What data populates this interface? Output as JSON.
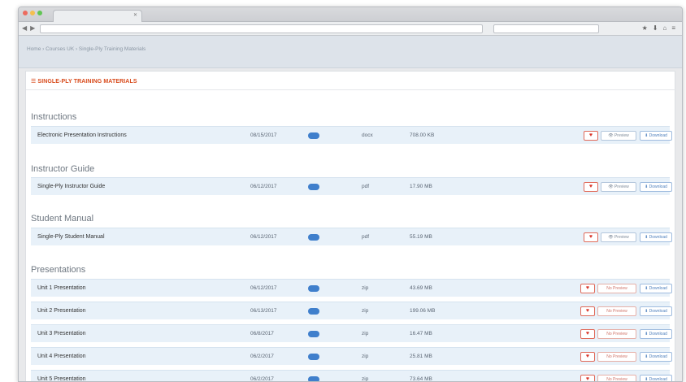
{
  "browser": {
    "tab_title": "",
    "tab_close": "✕",
    "url": "",
    "search_placeholder": "",
    "nav_back": "◀",
    "nav_forward": "▶",
    "toolbar_icons": [
      "★",
      "⬇",
      "⌂",
      "≡"
    ]
  },
  "breadcrumb": {
    "text": "Home › Courses UK › Single-Ply Training Materials"
  },
  "page": {
    "title": "☰ SINGLE-PLY TRAINING MATERIALS"
  },
  "sections": [
    {
      "heading": "Instructions",
      "rows": [
        {
          "name": "Electronic Presentation Instructions",
          "date": "08/15/2017",
          "type": "docx",
          "size": "708.00 KB",
          "preview": "👁 Preview",
          "download": "⬇ Download",
          "fav": "♥"
        }
      ]
    },
    {
      "heading": "Instructor Guide",
      "rows": [
        {
          "name": "Single-Ply Instructor Guide",
          "date": "06/12/2017",
          "type": "pdf",
          "size": "17.90 MB",
          "preview": "👁 Preview",
          "download": "⬇ Download",
          "fav": "♥"
        }
      ]
    },
    {
      "heading": "Student Manual",
      "rows": [
        {
          "name": "Single-Ply Student Manual",
          "date": "06/12/2017",
          "type": "pdf",
          "size": "55.19 MB",
          "preview": "👁 Preview",
          "download": "⬇ Download",
          "fav": "♥"
        }
      ]
    },
    {
      "heading": "Presentations",
      "rows": [
        {
          "name": "Unit 1 Presentation",
          "date": "06/12/2017",
          "type": "zip",
          "size": "43.69 MB",
          "preview": "No Preview",
          "download": "⬇ Download",
          "fav": "♥"
        },
        {
          "name": "Unit 2 Presentation",
          "date": "06/13/2017",
          "type": "zip",
          "size": "199.06 MB",
          "preview": "No Preview",
          "download": "⬇ Download",
          "fav": "♥"
        },
        {
          "name": "Unit 3 Presentation",
          "date": "06/8/2017",
          "type": "zip",
          "size": "16.47 MB",
          "preview": "No Preview",
          "download": "⬇ Download",
          "fav": "♥"
        },
        {
          "name": "Unit 4 Presentation",
          "date": "06/2/2017",
          "type": "zip",
          "size": "25.81 MB",
          "preview": "No Preview",
          "download": "⬇ Download",
          "fav": "♥"
        },
        {
          "name": "Unit 5 Presentation",
          "date": "06/2/2017",
          "type": "zip",
          "size": "73.64 MB",
          "preview": "No Preview",
          "download": "⬇ Download",
          "fav": "♥"
        }
      ]
    }
  ],
  "colors": {
    "accent": "#d84a1b",
    "pill": "#3f7fcc",
    "row_bg": "#e8f1f9",
    "fav": "#d9362b"
  }
}
